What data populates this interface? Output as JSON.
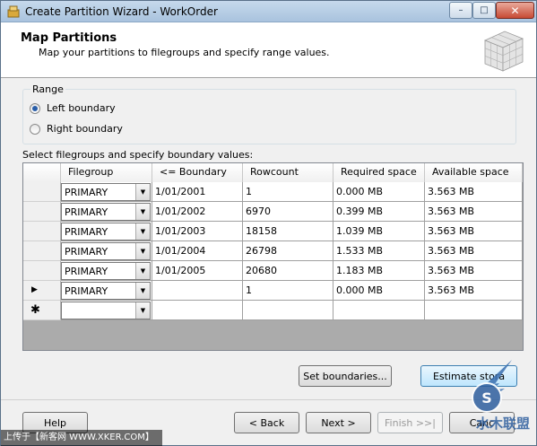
{
  "window": {
    "title": "Create Partition Wizard - WorkOrder",
    "minimize": "–",
    "maximize": "□",
    "close": "✕"
  },
  "header": {
    "title": "Map Partitions",
    "subtitle": "Map your partitions to filegroups and specify range values."
  },
  "range": {
    "label": "Range",
    "options": [
      {
        "label": "Left boundary",
        "selected": true
      },
      {
        "label": "Right boundary",
        "selected": false
      }
    ]
  },
  "grid": {
    "caption": "Select filegroups and specify boundary values:",
    "columns": [
      "Filegroup",
      "<= Boundary",
      "Rowcount",
      "Required space",
      "Available space"
    ],
    "rows": [
      {
        "filegroup": "PRIMARY",
        "boundary": "1/01/2001",
        "rowcount": "1",
        "required": "0.000 MB",
        "available": "3.563 MB"
      },
      {
        "filegroup": "PRIMARY",
        "boundary": "1/01/2002",
        "rowcount": "6970",
        "required": "0.399 MB",
        "available": "3.563 MB"
      },
      {
        "filegroup": "PRIMARY",
        "boundary": "1/01/2003",
        "rowcount": "18158",
        "required": "1.039 MB",
        "available": "3.563 MB"
      },
      {
        "filegroup": "PRIMARY",
        "boundary": "1/01/2004",
        "rowcount": "26798",
        "required": "1.533 MB",
        "available": "3.563 MB"
      },
      {
        "filegroup": "PRIMARY",
        "boundary": "1/01/2005",
        "rowcount": "20680",
        "required": "1.183 MB",
        "available": "3.563 MB"
      },
      {
        "filegroup": "PRIMARY",
        "boundary": "",
        "rowcount": "1",
        "required": "0.000 MB",
        "available": "3.563 MB"
      }
    ],
    "current_row_marker": "▶",
    "new_row_marker": "✱"
  },
  "buttons": {
    "set_boundaries": "Set boundaries...",
    "estimate_storage": "Estimate stora",
    "help": "Help",
    "back": "< Back",
    "next": "Next >",
    "finish": "Finish >>|",
    "cancel": "Canc"
  },
  "watermark": {
    "text": "上传于【新客网 WWW.XKER.COM】",
    "logo_text": "水木联盟"
  }
}
